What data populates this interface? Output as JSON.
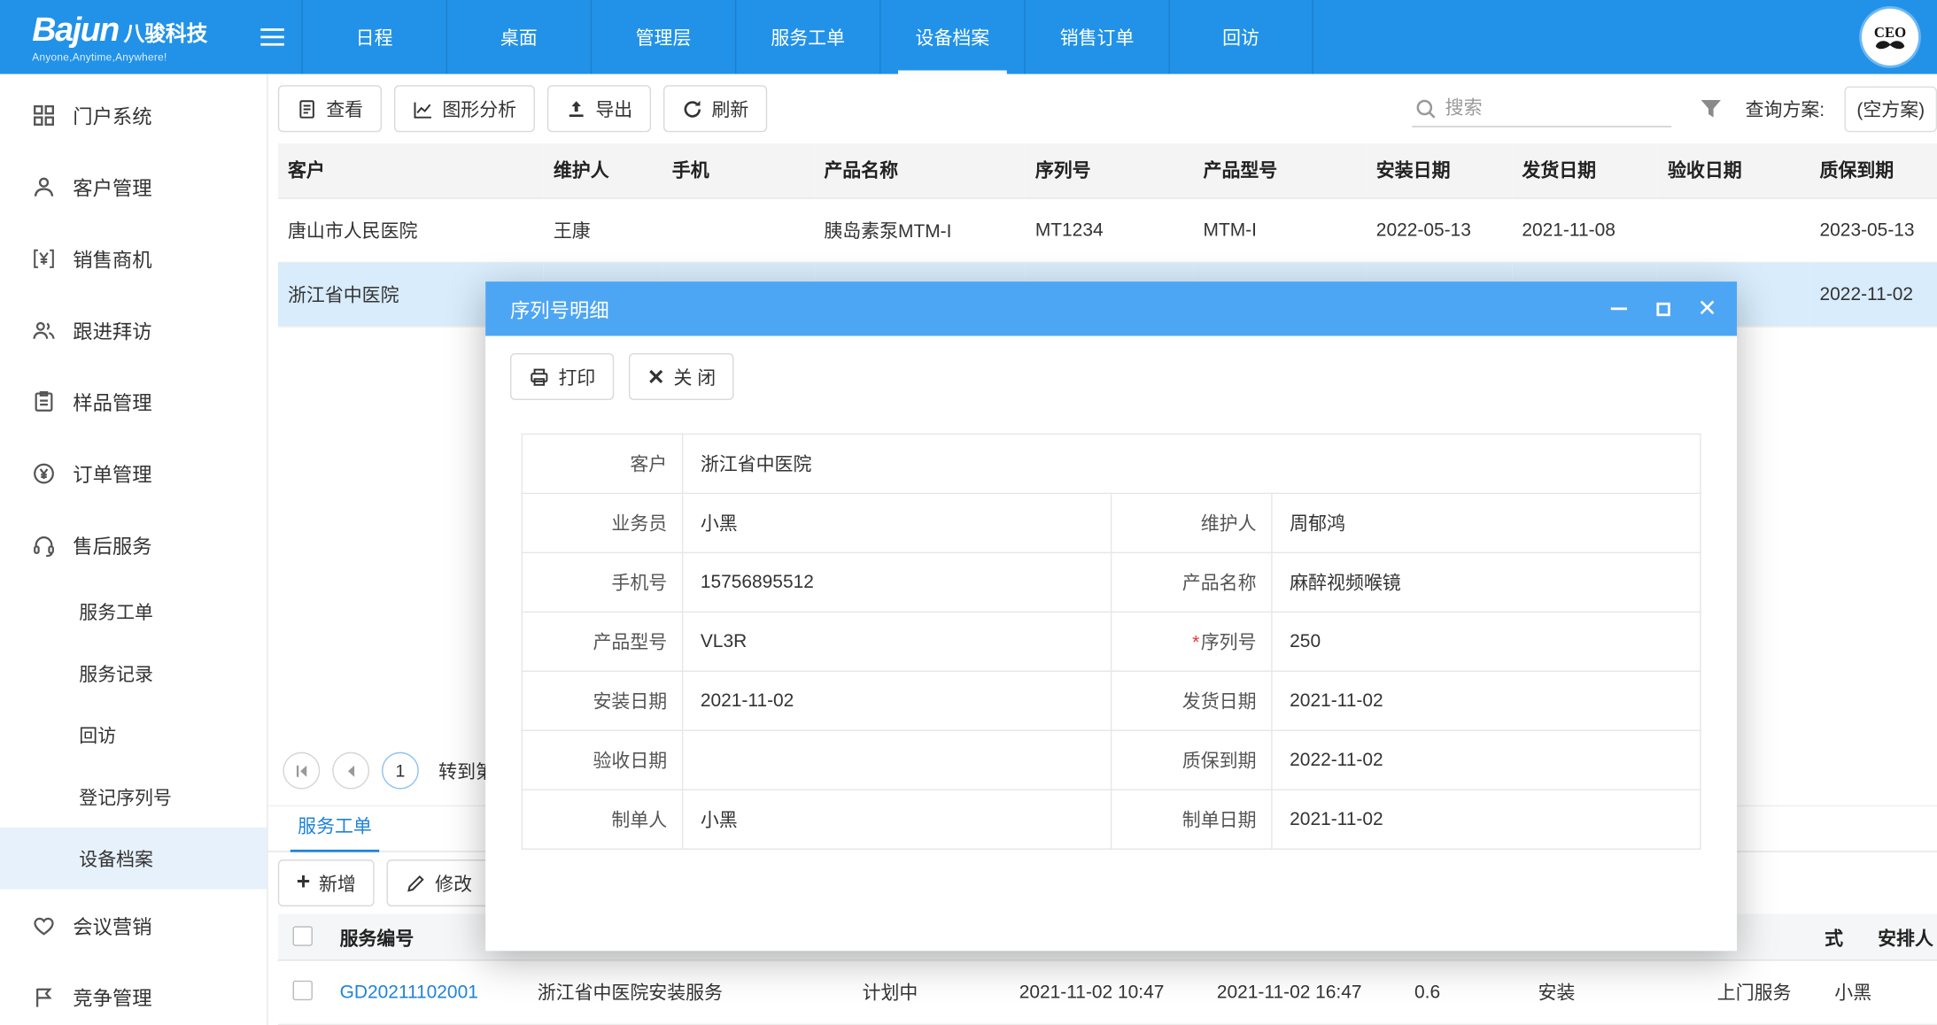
{
  "colors": {
    "topbar_blue": "#2192e8",
    "modal_header_blue": "#4da6f4",
    "link_blue": "#1f83d8",
    "selected_row_bg": "#d8ecfb",
    "required_red": "#e53935"
  },
  "topbar": {
    "brand": "Bajun",
    "brand_cn": "八骏科技",
    "tagline": "Anyone,Anytime,Anywhere!",
    "nav": [
      {
        "label": "日程"
      },
      {
        "label": "桌面"
      },
      {
        "label": "管理层"
      },
      {
        "label": "服务工单"
      },
      {
        "label": "设备档案"
      },
      {
        "label": "销售订单"
      },
      {
        "label": "回访"
      }
    ],
    "avatar": "CEO"
  },
  "sidebar": {
    "items": [
      {
        "label": "门户系统",
        "icon": "grid-icon"
      },
      {
        "label": "客户管理",
        "icon": "user-icon"
      },
      {
        "label": "销售商机",
        "icon": "yen-bracket-icon"
      },
      {
        "label": "跟进拜访",
        "icon": "users-icon"
      },
      {
        "label": "样品管理",
        "icon": "clipboard-icon"
      },
      {
        "label": "订单管理",
        "icon": "yen-circle-icon"
      },
      {
        "label": "售后服务",
        "icon": "headset-icon"
      }
    ],
    "sub_items": [
      {
        "label": "服务工单"
      },
      {
        "label": "服务记录"
      },
      {
        "label": "回访"
      },
      {
        "label": "登记序列号"
      },
      {
        "label": "设备档案"
      }
    ],
    "items_bottom": [
      {
        "label": "会议营销",
        "icon": "heart-icon"
      },
      {
        "label": "竞争管理",
        "icon": "flag-icon"
      }
    ]
  },
  "toolbar": {
    "view": "查看",
    "chart": "图形分析",
    "export": "导出",
    "refresh": "刷新",
    "search_placeholder": "搜索",
    "plan_label": "查询方案:",
    "plan_value": "(空方案)"
  },
  "device_table": {
    "columns": [
      "客户",
      "维护人",
      "手机",
      "产品名称",
      "序列号",
      "产品型号",
      "安装日期",
      "发货日期",
      "验收日期",
      "质保到期"
    ],
    "row1": [
      "唐山市人民医院",
      "王康",
      "",
      "胰岛素泵MTM-I",
      "MT1234",
      "MTM-I",
      "2022-05-13",
      "2021-11-08",
      "",
      "2023-05-13"
    ],
    "row2": [
      "浙江省中医院",
      "",
      "",
      "",
      "",
      "",
      "",
      "",
      "",
      "2022-11-02"
    ]
  },
  "pager": {
    "page": "1",
    "goto_label": "转到第"
  },
  "tabs": {
    "service": "服务工单"
  },
  "sub_toolbar": {
    "add": "新增",
    "edit": "修改"
  },
  "service_table": {
    "col_id": "服务编号",
    "col_mode_fragment": "式",
    "col_assignee": "安排人",
    "row": [
      "GD20211102001",
      "浙江省中医院安装服务",
      "计划中",
      "2021-11-02 10:47",
      "2021-11-02 16:47",
      "0.6",
      "安装",
      "上门服务",
      "小黑"
    ]
  },
  "modal": {
    "title": "序列号明细",
    "print": "打印",
    "close": "关 闭",
    "required_mark": "*",
    "rows": [
      {
        "l1": "客户",
        "v1": "浙江省中医院"
      },
      {
        "l1": "业务员",
        "v1": "小黑",
        "l2": "维护人",
        "v2": "周郁鸿"
      },
      {
        "l1": "手机号",
        "v1": "15756895512",
        "l2": "产品名称",
        "v2": "麻醉视频喉镜"
      },
      {
        "l1": "产品型号",
        "v1": "VL3R",
        "l2": "序列号",
        "v2": "250"
      },
      {
        "l1": "安装日期",
        "v1": "2021-11-02",
        "l2": "发货日期",
        "v2": "2021-11-02"
      },
      {
        "l1": "验收日期",
        "v1": "",
        "l2": "质保到期",
        "v2": "2022-11-02"
      },
      {
        "l1": "制单人",
        "v1": "小黑",
        "l2": "制单日期",
        "v2": "2021-11-02"
      }
    ]
  }
}
